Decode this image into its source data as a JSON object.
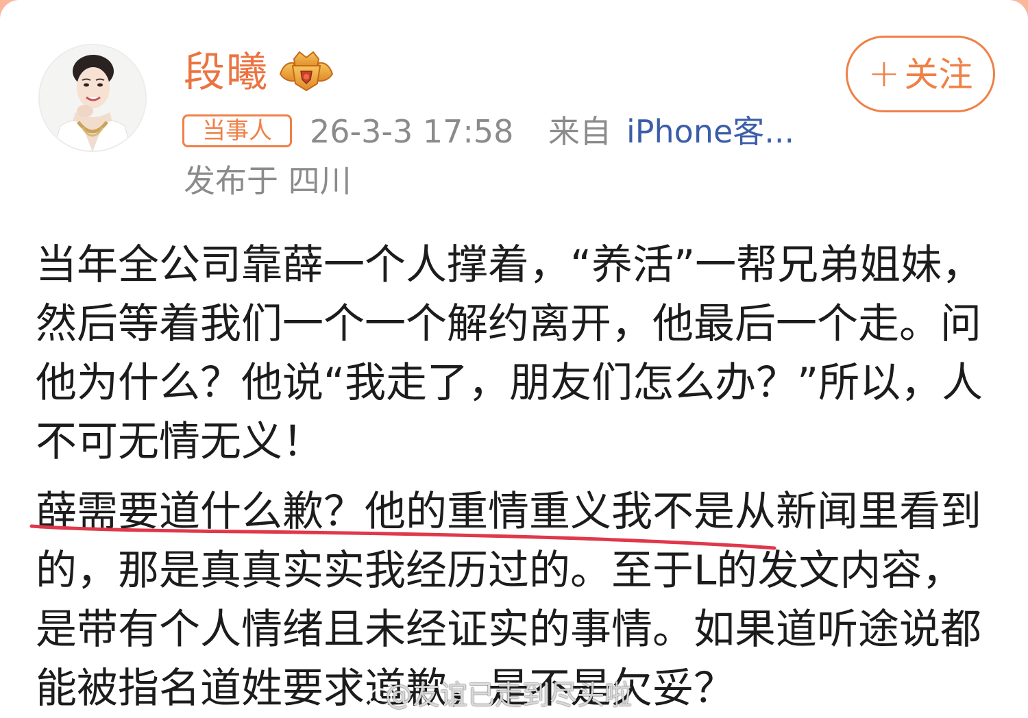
{
  "user": {
    "name": "段曦",
    "role_tag": "当事人",
    "avatar_icon": "profile-photo"
  },
  "follow_button": {
    "plus": "+",
    "label": "关注"
  },
  "meta": {
    "time": "26-3-3 17:58",
    "from_label": "来自",
    "source": "iPhone客...",
    "location": "发布于 四川"
  },
  "post": {
    "paragraph_1": "当年全公司靠薛一个人撑着，“养活”一帮兄弟姐妹，然后等着我们一个一个解约离开，他最后一个走。问他为什么？他说“我走了，朋友们怎么办？”所以，人不可无情无义！",
    "paragraph_2": "薛需要道什么歉？他的重情重义我不是从新闻里看到的，那是真真实实我经历过的。至于L的发文内容，是带有个人情绪且未经证实的事情。如果道听途说都能被指名道姓要求道歉，是不是欠妥？"
  },
  "watermark": {
    "text": "@友谊已走到尽头啦",
    "logo_icon": "weibo-logo-icon"
  },
  "colors": {
    "accent": "#ef8047",
    "username": "#eb7340",
    "link": "#3b5ea8",
    "meta": "#8b8b8b",
    "text": "#1c1c1c",
    "underline": "#e0384a"
  }
}
